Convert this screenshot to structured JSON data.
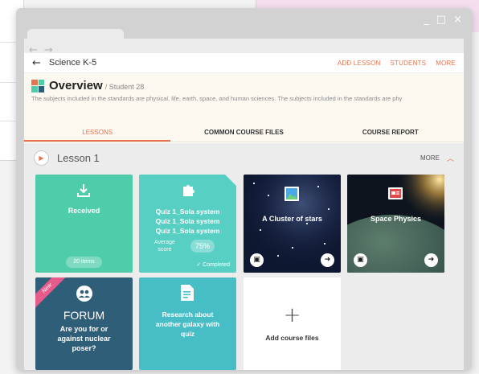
{
  "browser": {
    "window_controls": [
      "_",
      "□",
      "×"
    ],
    "back_arrow": "←",
    "forward_arrow": "→"
  },
  "header": {
    "back_arrow": "←",
    "course_name": "Science K-5",
    "actions": [
      "ADD LESSON",
      "STUDENTS",
      "MORE"
    ]
  },
  "overview": {
    "title": "Overview",
    "subtitle": "/ Student 28",
    "description": "The subjects included in the standards are physical, life, earth, space, and human sciences. The subjects included in the standards are phy"
  },
  "tabs": [
    "LESSONS",
    "COMMON COURSE FILES",
    "COURSE REPORT"
  ],
  "lesson": {
    "title": "Lesson 1",
    "more_label": "MORE",
    "play_icon": "▶",
    "chevron": "︿"
  },
  "cards": {
    "received": {
      "title": "Received",
      "count": "20 items"
    },
    "quiz": {
      "lines": [
        "Quiz 1_Sola system",
        "Quiz 1_Sola system",
        "Quiz 1_Sola system"
      ],
      "avg_label_1": "Average",
      "avg_label_2": "score",
      "score": "75%",
      "status": "✓ Completed"
    },
    "stars": {
      "title": "A Cluster of stars"
    },
    "space": {
      "title": "Space Physics"
    },
    "forum": {
      "ribbon": "New",
      "title": "FORUM",
      "question_1": "Are you for or",
      "question_2": "against nuclear",
      "question_3": "poser?"
    },
    "research": {
      "text": "Research about another galaxy with quiz"
    },
    "add": {
      "plus": "+",
      "label": "Add course files"
    }
  },
  "colors": {
    "accent": "#e8744d",
    "received": "#4fcca9",
    "quiz": "#58cfc3",
    "forum": "#2f5e78",
    "research": "#47bec6"
  }
}
